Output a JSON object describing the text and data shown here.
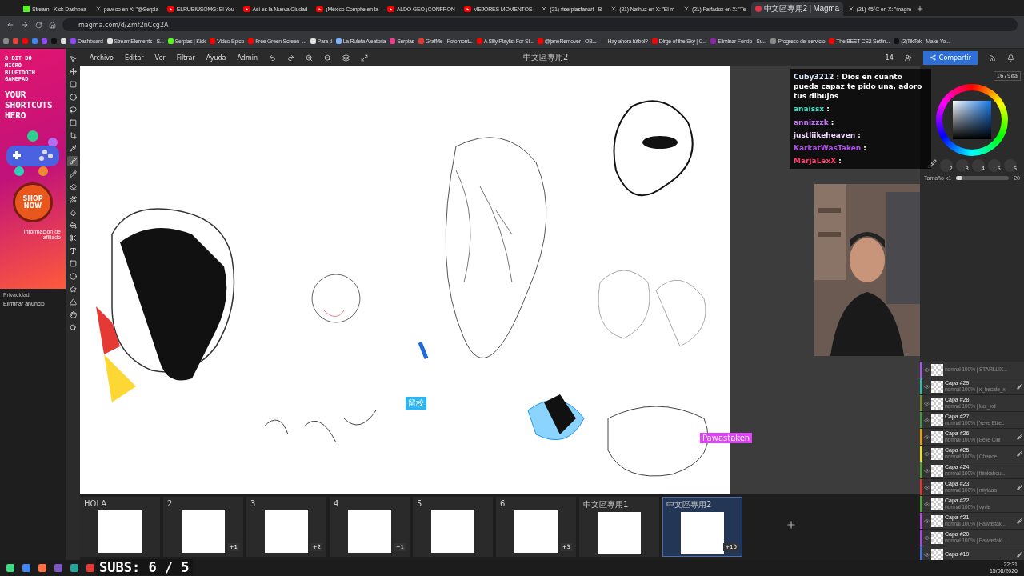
{
  "browser": {
    "tabs": [
      {
        "kind": "kick",
        "title": "Stream - Kick Dashboa",
        "selected": false
      },
      {
        "kind": "x",
        "title": "paw co en X: \"@Serpia",
        "selected": false
      },
      {
        "kind": "youtube",
        "title": "ELRUBIUSOMG: El You",
        "selected": false
      },
      {
        "kind": "youtube",
        "title": "Así es la Nueva Ciudad",
        "selected": false
      },
      {
        "kind": "youtube",
        "title": "¡México Compite en la",
        "selected": false
      },
      {
        "kind": "youtube",
        "title": "ALDO GEO ¡CONFRON",
        "selected": false
      },
      {
        "kind": "youtube",
        "title": "MEJORES MOMENTOS",
        "selected": false
      },
      {
        "kind": "x",
        "title": "(21) #serpiasfanart - B",
        "selected": false
      },
      {
        "kind": "x",
        "title": "(21) Nathuz en X: \"El m",
        "selected": false
      },
      {
        "kind": "x",
        "title": "(21) Farfadox en X: \"Te",
        "selected": false
      },
      {
        "kind": "magma",
        "title": "中文區專用2 | Magma",
        "selected": true
      },
      {
        "kind": "x",
        "title": "(21) 45°C en X: \"magm",
        "selected": false
      }
    ],
    "url": "magma.com/d/Zmf2nCcg2A",
    "bookmarks": [
      {
        "label": "Dashboard",
        "color": "#9146ff"
      },
      {
        "label": "StreamElements - S...",
        "color": "#e0e0e0"
      },
      {
        "label": "Serpias | Kick",
        "color": "#53fc18"
      },
      {
        "label": "Video Epico",
        "color": "#ff0000"
      },
      {
        "label": "Free Green Screen -...",
        "color": "#ff0000"
      },
      {
        "label": "Para ti",
        "color": "#e0e0e0"
      },
      {
        "label": "La Ruleta Aleatoria",
        "color": "#7fb2ff"
      },
      {
        "label": "Serpias",
        "color": "#e83e8c"
      },
      {
        "label": "GrafMe - Fotomont...",
        "color": "#e53935"
      },
      {
        "label": "A Silly Playlist For Si...",
        "color": "#ff0000"
      },
      {
        "label": "@janeRemover - OB...",
        "color": "#ff0000"
      },
      {
        "label": "Hay ahora fútbol?",
        "color": "#333333"
      },
      {
        "label": "Dirge of the Sky | C...",
        "color": "#ff0000"
      },
      {
        "label": "Eliminar Fondo - Su...",
        "color": "#8e24aa"
      },
      {
        "label": "Progreso del servicio",
        "color": "#888888"
      },
      {
        "label": "The BEST CS2 Settin...",
        "color": "#ff0000"
      },
      {
        "label": "(2)TikTok - Make Yo...",
        "color": "#111111"
      }
    ]
  },
  "ad": {
    "heading": "8 BIT DO MICRO BLUETOOTH GAMEPAD",
    "slogan": "YOUR SHORTCUTS HERO",
    "button": "SHOP NOW",
    "note": "Información de afiliado",
    "privacy": "Privacidad",
    "remove": "Eliminar anuncio"
  },
  "app": {
    "menu": [
      "Archivo",
      "Editar",
      "Ver",
      "Filtrar",
      "Ayuda",
      "Admin"
    ],
    "document_title": "中文區專用2",
    "user_count": "14",
    "share_button": "Compartir",
    "tools": [
      {
        "selected": false
      },
      {
        "selected": false
      },
      {
        "selected": false
      },
      {
        "selected": false
      },
      {
        "selected": false
      },
      {
        "selected": false
      },
      {
        "selected": false
      },
      {
        "selected": false
      },
      {
        "selected": true
      },
      {
        "selected": false
      },
      {
        "selected": false
      },
      {
        "selected": false
      },
      {
        "selected": false
      },
      {
        "selected": false
      },
      {
        "selected": false
      },
      {
        "selected": false
      },
      {
        "selected": false
      },
      {
        "selected": false
      },
      {
        "selected": false
      },
      {
        "selected": false
      },
      {
        "selected": false
      },
      {
        "selected": false
      }
    ],
    "cursors": [
      {
        "label": "留校",
        "color": "#29b6f6"
      },
      {
        "label": "Pawastaken",
        "color": "#e040fb"
      }
    ],
    "color_hex": "1679ea",
    "brush_slots": [
      "2",
      "3",
      "4",
      "5",
      "6"
    ],
    "size_label": "Tamaño x1",
    "size_slider": {
      "level": 0.12
    },
    "size_value": "20",
    "layers": [
      {
        "meta": "normal 100% | STARLLIX...",
        "brush": false,
        "color": "#9c5fd6"
      },
      {
        "name": "Capa #29",
        "meta": "normal 100% | x_hecate_x",
        "brush": true,
        "color": "#3fb5a5"
      },
      {
        "name": "Capa #28",
        "meta": "normal 100% | luo _xd",
        "brush": false,
        "color": "#7a8a3a"
      },
      {
        "name": "Capa #27",
        "meta": "normal 100% | Yeye Ettie..",
        "brush": false,
        "color": "#4f8f4f"
      },
      {
        "name": "Capa #26",
        "meta": "normal 100% | Belle Cini",
        "brush": true,
        "color": "#e0a020"
      },
      {
        "name": "Capa #25",
        "meta": "normal 100% | Chance",
        "brush": true,
        "color": "#e8e040"
      },
      {
        "name": "Capa #24",
        "meta": "normal 100% | thinkabou...",
        "brush": false,
        "color": "#5a9a40"
      },
      {
        "name": "Capa #23",
        "meta": "normal 100% | miyiaaa",
        "brush": true,
        "color": "#d03a3a"
      },
      {
        "name": "Capa #22",
        "meta": "normal 100% | vyvie",
        "brush": false,
        "color": "#5aa040"
      },
      {
        "name": "Capa #21",
        "meta": "normal 100% | Pawastak...",
        "brush": true,
        "color": "#b050d0"
      },
      {
        "name": "Capa #20",
        "meta": "normal 100% | Pawastak...",
        "brush": false,
        "color": "#9a50d0"
      },
      {
        "name": "Capa #19",
        "brush": true,
        "color": "#5070d0"
      }
    ],
    "boards": [
      {
        "title": "HOLA",
        "selected": false
      },
      {
        "title": "2",
        "extra": "+1",
        "selected": false
      },
      {
        "title": "3",
        "extra": "+2",
        "selected": false
      },
      {
        "title": "4",
        "extra": "+1",
        "selected": false
      },
      {
        "title": "5",
        "selected": false
      },
      {
        "title": "6",
        "extra": "+3",
        "selected": false
      },
      {
        "title": "中文區專用1",
        "selected": false
      },
      {
        "title": "中文區專用2",
        "extra": "+10",
        "selected": true
      }
    ]
  },
  "chat": [
    {
      "user": "Cuby3212",
      "text": ": Dios en cuanto pueda capaz te pido una, adoro tus dibujos",
      "color": "#dce8ff"
    },
    {
      "user": "anaissx",
      "text": ":",
      "color": "#3ee0c8"
    },
    {
      "user": "annizzzk",
      "text": ":",
      "color": "#c070f0"
    },
    {
      "user": "justliikeheaven",
      "text": ":",
      "color": "#f0d8ff"
    },
    {
      "user": "KarkatWasTaken",
      "text": ":",
      "color": "#b050e8"
    },
    {
      "user": "MarjaLexX",
      "text": ":",
      "color": "#ff3d6e"
    }
  ],
  "overlay": {
    "subs": "SUBS: 6 / 5"
  },
  "taskbar": {
    "time": "22:31",
    "date": "15/08/2026"
  }
}
